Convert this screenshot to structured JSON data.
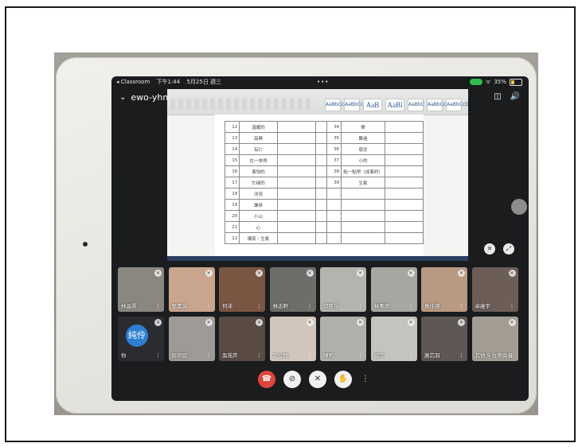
{
  "status": {
    "back_app": "◂ Classroom",
    "time": "下午1:44",
    "date": "5月25日 週三",
    "dots": "•••",
    "battery": "35%"
  },
  "meeting": {
    "code": "ewo-yhmu-nft"
  },
  "document": {
    "style_samples": [
      "AaBbCcDd",
      "AaBbCcDd",
      "AaB",
      "AaBl",
      "AaBbC",
      "AaBbCcD",
      "AaBbCcD"
    ],
    "rows": [
      {
        "n": "12",
        "name": "溫暖的",
        "n2": "34",
        "name2": "樂"
      },
      {
        "n": "13",
        "name": "高興",
        "n2": "35",
        "name2": "難過"
      },
      {
        "n": "14",
        "name": "有仁",
        "n2": "36",
        "name2": "慈念"
      },
      {
        "n": "15",
        "name": "在一來得",
        "n2": "37",
        "name2": "小的"
      },
      {
        "n": "16",
        "name": "害怕的",
        "n2": "38",
        "name2": "點一點吧（成事的）"
      },
      {
        "n": "17",
        "name": "忙碌的",
        "n2": "39",
        "name2": "生氣"
      },
      {
        "n": "18",
        "name": "河流",
        "n2": "",
        "name2": ""
      },
      {
        "n": "19",
        "name": "謙恭",
        "n2": "",
        "name2": ""
      },
      {
        "n": "20",
        "name": "小山",
        "n2": "",
        "name2": ""
      },
      {
        "n": "21",
        "name": "心",
        "n2": "",
        "name2": ""
      },
      {
        "n": "22",
        "name": "講笑・生氣",
        "n2": "",
        "name2": ""
      }
    ]
  },
  "participants": [
    {
      "name": "林晶渠",
      "bg": "#8a8680"
    },
    {
      "name": "張書誠",
      "bg": "#c9a58e"
    },
    {
      "name": "何沛",
      "bg": "#7a5542"
    },
    {
      "name": "林志軒",
      "bg": "#6f6d69"
    },
    {
      "name": "邱凱苗",
      "bg": "#b5b3ae"
    },
    {
      "name": "林事胡",
      "bg": "#a8a6a1"
    },
    {
      "name": "黃佳瑛",
      "bg": "#b89a83"
    },
    {
      "name": "卓維宇",
      "bg": "#6c5d57"
    },
    {
      "name": "你",
      "bg": "#2a2c2f",
      "avatar": "純伶"
    },
    {
      "name": "周玥庭",
      "bg": "#9e9a95"
    },
    {
      "name": "吳苑芹",
      "bg": "#5a4a44"
    },
    {
      "name": "李立翔",
      "bg": "#d1c6bb"
    },
    {
      "name": "陳明",
      "bg": "#b2b0ab"
    },
    {
      "name": "晉宇",
      "bg": "#c5c3be"
    },
    {
      "name": "謝芯羽",
      "bg": "#5e5753"
    },
    {
      "name": "其他 9 位參與者",
      "bg": "#a49d94"
    }
  ]
}
